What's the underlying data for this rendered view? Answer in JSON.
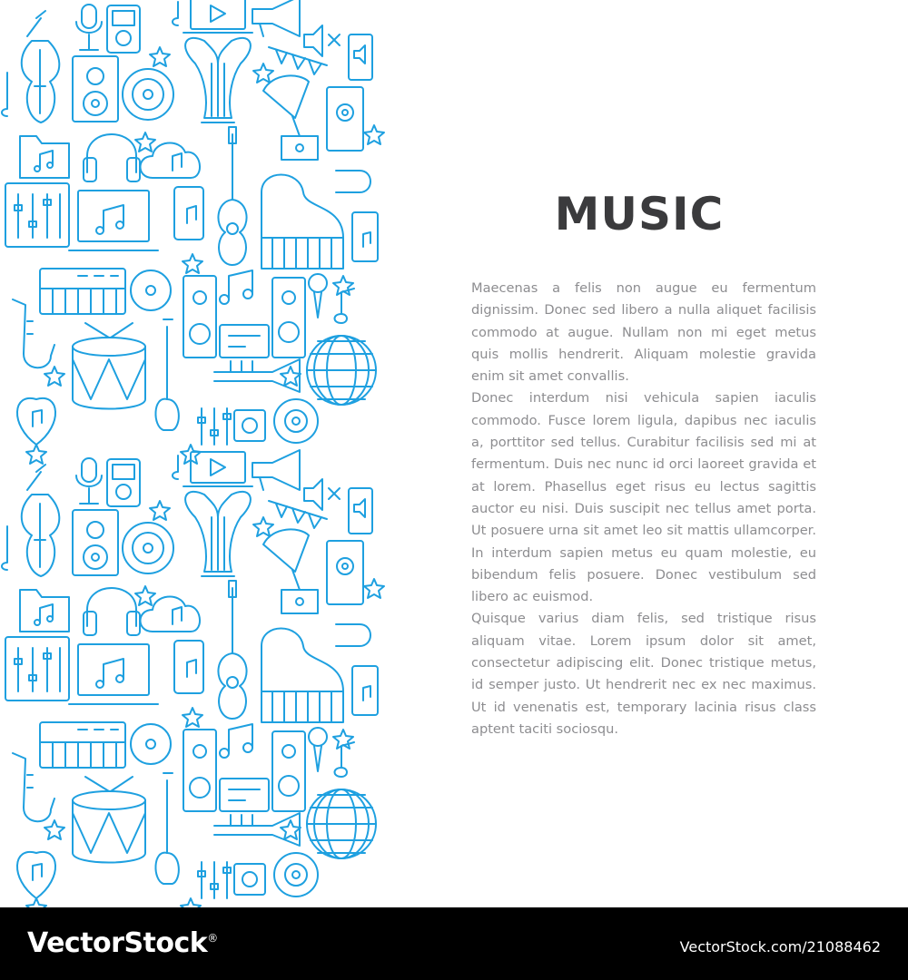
{
  "pattern": {
    "stroke_color": "#1ea0e0",
    "icons": [
      "guitar-icon",
      "violin-icon",
      "microphone-icon",
      "speaker-icon",
      "vinyl-icon",
      "headphones-icon",
      "music-note-icon",
      "cloud-music-icon",
      "mixer-icon",
      "laptop-music-icon",
      "smartphone-music-icon",
      "acoustic-guitar-icon",
      "piano-icon",
      "keyboard-icon",
      "cd-icon",
      "drum-icon",
      "trumpet-icon",
      "disco-ball-icon",
      "lyre-icon",
      "gramophone-icon",
      "megaphone-icon",
      "mute-icon",
      "heart-music-icon",
      "star-icon",
      "saxophone-icon",
      "radio-icon",
      "music-player-icon",
      "electric-guitar-icon",
      "cable-icon",
      "folder-music-icon"
    ]
  },
  "page": {
    "title": "MUSIC",
    "paragraphs": [
      "Maecenas a felis non augue eu fermentum dignissim. Donec sed libero a nulla aliquet facilisis commodo at augue. Nullam non mi eget metus quis mollis hendrerit. Aliquam molestie gravida enim sit amet convallis.",
      "Donec interdum nisi vehicula sapien iaculis commodo. Fusce lorem ligula, dapibus nec iaculis a, porttitor sed tellus. Curabitur facilisis sed mi at fermentum. Duis nec nunc id orci laoreet gravida et at lorem. Phasellus eget risus eu lectus sagittis auctor eu nisi. Duis suscipit nec tellus amet porta. Ut posuere urna sit amet leo sit mattis ullamcorper. In interdum sapien metus eu quam molestie, eu bibendum felis posuere. Donec vestibulum sed libero ac euismod.",
      "Quisque varius diam felis, sed tristique risus aliquam vitae. Lorem ipsum dolor sit amet, consectetur adipiscing elit. Donec tristique metus, id semper justo. Ut hendrerit nec ex nec maximus. Ut id venenatis est, temporary lacinia risus class aptent taciti sociosqu."
    ]
  },
  "footer": {
    "logo_text": "VectorStock",
    "logo_mark": "®",
    "credit": "VectorStock.com/21088462"
  },
  "colors": {
    "title": "#3b3b3d",
    "body_text": "#8d8d90",
    "pattern_line": "#1ea0e0",
    "footer_bg": "#000000"
  }
}
